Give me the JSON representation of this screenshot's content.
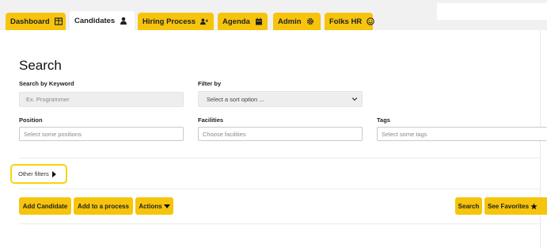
{
  "nav": {
    "tabs": [
      {
        "label": "Dashboard",
        "icon": "table-icon"
      },
      {
        "label": "Candidates",
        "icon": "user-icon",
        "active": true
      },
      {
        "label": "Hiring Process",
        "icon": "user-plus-icon"
      },
      {
        "label": "Agenda",
        "icon": "calendar-icon"
      },
      {
        "label": "Admin",
        "icon": "gear-icon"
      },
      {
        "label": "Folks HR",
        "icon": "smile-icon"
      }
    ]
  },
  "search": {
    "title": "Search",
    "keyword_label": "Search by Keyword",
    "keyword_placeholder": "Ex. Programmer",
    "filter_label": "Filter by",
    "filter_selected": "Select a sort option ...",
    "position_label": "Position",
    "position_placeholder": "Select some positions",
    "facilities_label": "Facilities",
    "facilities_placeholder": "Choose facilities",
    "tags_label": "Tags",
    "tags_placeholder": "Select some tags",
    "other_filters": "Other filters"
  },
  "actions": {
    "add_candidate": "Add Candidate",
    "add_to_process": "Add to a process",
    "actions": "Actions",
    "search": "Search",
    "see_favorites": "See Favorites"
  },
  "colors": {
    "accent": "#f6c40d",
    "highlight_border": "#f6d40d",
    "topbar_bg": "#f1f1f1"
  }
}
